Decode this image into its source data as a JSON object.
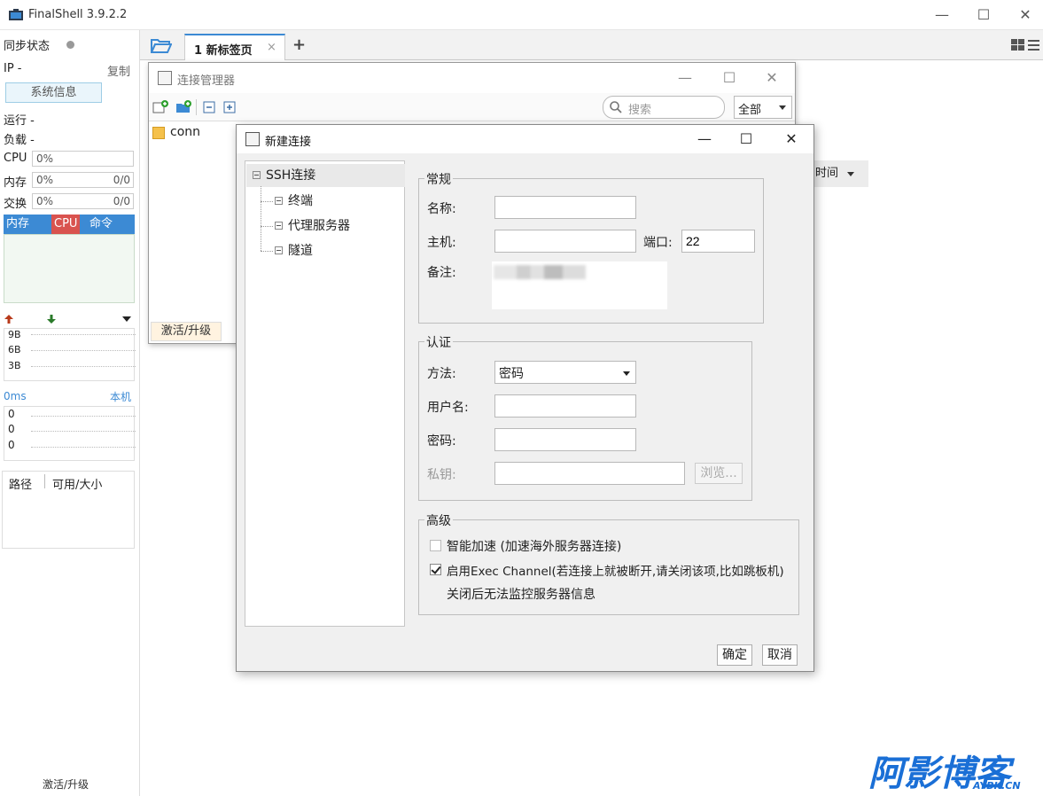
{
  "app": {
    "title": "FinalShell 3.9.2.2"
  },
  "window_controls": {
    "minimize": "—",
    "maximize": "☐",
    "close": "✕"
  },
  "sidebar": {
    "sync_status": "同步状态",
    "ip_label": "IP -",
    "copy_label": "复制",
    "sysinfo_button": "系统信息",
    "uptime": "运行 -",
    "load": "负载 -",
    "cpu_label": "CPU",
    "cpu_value": "0%",
    "mem_label": "内存",
    "mem_value": "0%",
    "mem_count": "0/0",
    "swap_label": "交换",
    "swap_value": "0%",
    "swap_count": "0/0",
    "proc_tabs": [
      "内存",
      "CPU",
      "命令"
    ],
    "net_labels": [
      "9B",
      "6B",
      "3B"
    ],
    "latency_label": "0ms",
    "latency_host": "本机",
    "latency_values": [
      "0",
      "0",
      "0"
    ],
    "disk_headers": [
      "路径",
      "可用/大小"
    ],
    "footer": "激活/升级"
  },
  "tabbar": {
    "tab_label": "1 新标签页",
    "tab_close": "×",
    "add_tab": "+"
  },
  "background": {
    "time_column": "时间"
  },
  "conn_manager": {
    "title": "连接管理器",
    "search_placeholder": "搜索",
    "filter_value": "全部",
    "items": [
      {
        "name": "conn"
      }
    ],
    "activate": "激活/升级"
  },
  "dialog": {
    "title": "新建连接",
    "tree": {
      "root": "SSH连接",
      "children": [
        "终端",
        "代理服务器",
        "隧道"
      ]
    },
    "general": {
      "group_title": "常规",
      "name_label": "名称:",
      "name_value": "",
      "host_label": "主机:",
      "host_value": "",
      "port_label": "端口:",
      "port_value": "22",
      "note_label": "备注:"
    },
    "auth": {
      "group_title": "认证",
      "method_label": "方法:",
      "method_value": "密码",
      "username_label": "用户名:",
      "username_value": "",
      "password_label": "密码:",
      "password_value": "",
      "key_label": "私钥:",
      "key_value": "",
      "browse_button": "浏览..."
    },
    "advanced": {
      "group_title": "高级",
      "smart_accel": "智能加速 (加速海外服务器连接)",
      "smart_accel_checked": false,
      "exec_channel": "启用Exec Channel(若连接上就被断开,请关闭该项,比如跳板机)",
      "exec_channel_checked": true,
      "exec_note": "关闭后无法监控服务器信息"
    },
    "ok_button": "确定",
    "cancel_button": "取消"
  },
  "watermark": {
    "text": "阿影博客",
    "sub": "AYBK.CN"
  },
  "colors": {
    "accent": "#3c8ad4",
    "cpu_tab": "#d9534f",
    "proc_bg": "#f2f8f2"
  }
}
